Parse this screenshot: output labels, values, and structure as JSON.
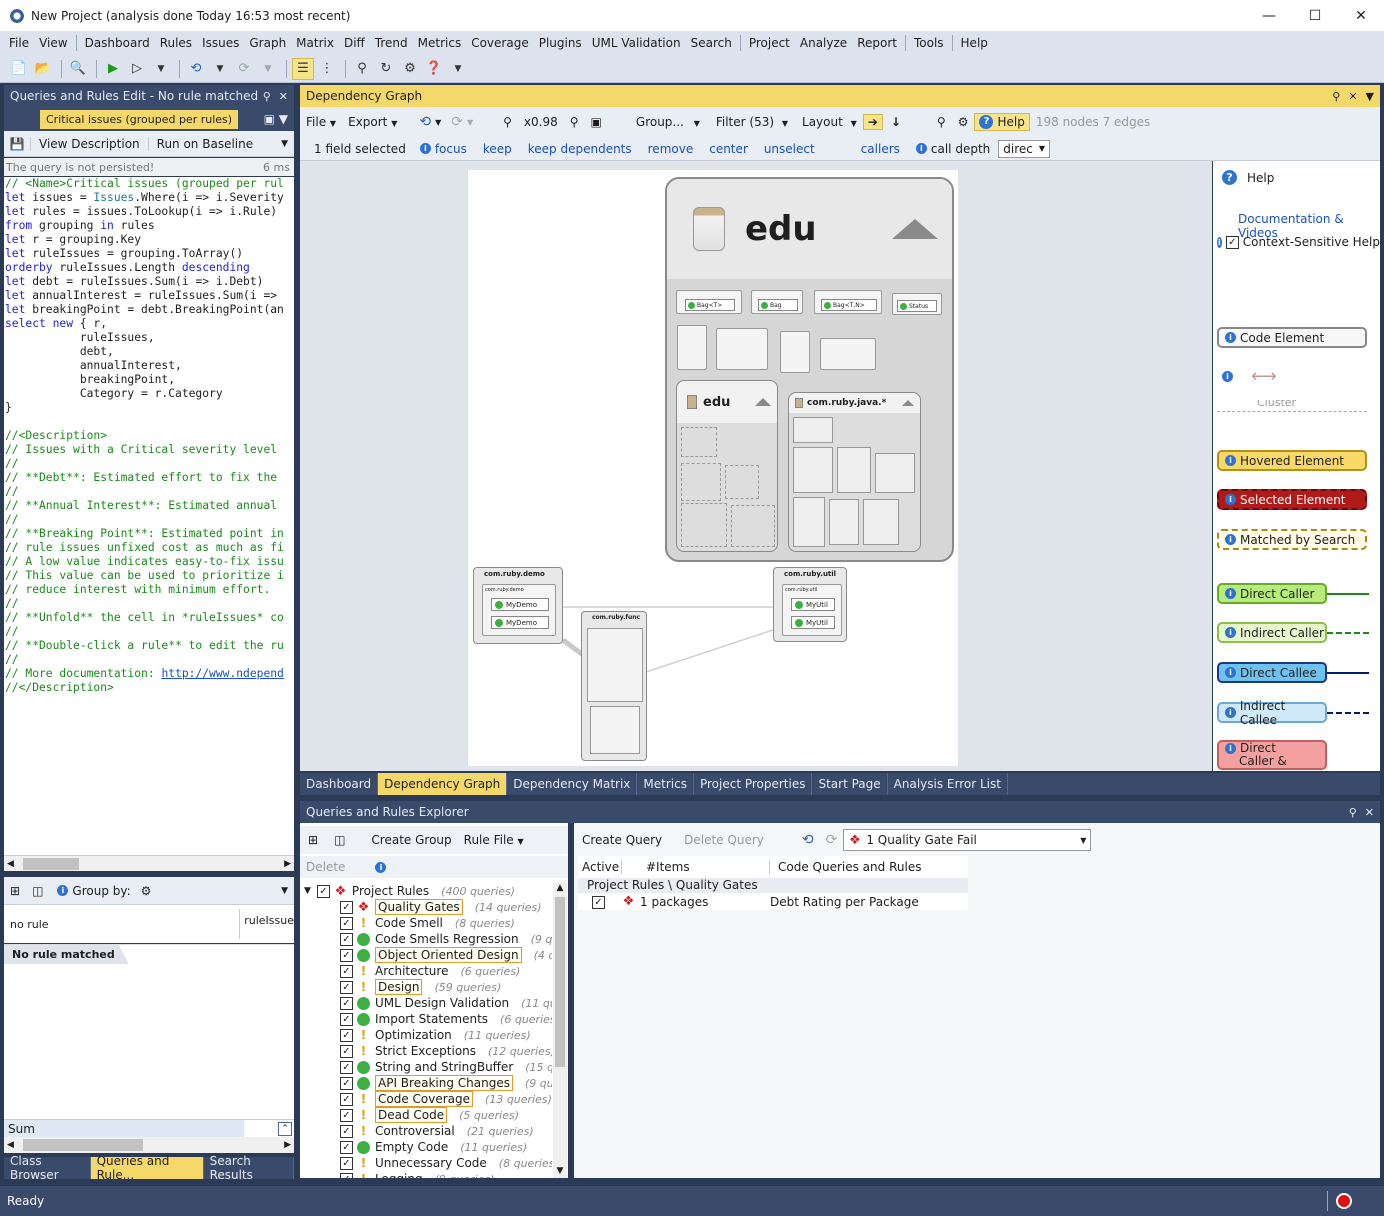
{
  "window": {
    "title": "New Project  (analysis done Today 16:53 most recent)"
  },
  "menu": [
    "File",
    "View",
    "Dashboard",
    "Rules",
    "Issues",
    "Graph",
    "Matrix",
    "Diff",
    "Trend",
    "Metrics",
    "Coverage",
    "Plugins",
    "UML Validation",
    "Search",
    "Project",
    "Analyze",
    "Report",
    "Tools",
    "Help"
  ],
  "left_panel": {
    "title": "Queries and Rules Edit  - No rule matched",
    "query_tab": "Critical issues (grouped per rules)",
    "view_description": "View Description",
    "run_on_baseline": "Run on Baseline",
    "status": "The query is not persisted!",
    "status_time": "6 ms",
    "group_by": "Group by:",
    "col_no_rule": "no rule",
    "col_ruleissues": "ruleIssue",
    "no_rule_matched": "No rule matched",
    "sum": "Sum"
  },
  "left_tabs": [
    "Class Browser",
    "Queries and Rule...",
    "Search Results"
  ],
  "graph_panel": {
    "title": "Dependency Graph",
    "file": "File",
    "export": "Export",
    "zoom": "x0.98",
    "group": "Group...",
    "filter": "Filter (53)",
    "layout": "Layout",
    "help": "Help",
    "stats": "198 nodes 7 edges",
    "selected": "1 field selected",
    "actions": [
      "focus",
      "keep",
      "keep dependents",
      "remove",
      "center",
      "unselect"
    ],
    "callers": "callers",
    "call_depth": "call depth",
    "direc": "direc"
  },
  "graph": {
    "edu_title": "edu",
    "edu_inner": "edu",
    "ruby_java": "com.ruby.java.*",
    "demo": "com.ruby.demo",
    "demo_inner": "com.ruby.demo",
    "my_demo_1": "MyDemo",
    "my_demo_2": "MyDemo",
    "func": "com.ruby.func",
    "util": "com.ruby.util",
    "util_inner": "com.ruby.util",
    "my_util_1": "MyUtil",
    "my_util_2": "MyUtil",
    "bag1": "Bag<T>",
    "bag2": "Bag",
    "bag3": "Bag<T,N>",
    "status": "Status"
  },
  "legend": {
    "help": "Help",
    "doc": "Documentation & Videos",
    "context": "Context-Sensitive Help",
    "code_element": "Code Element",
    "cluster": "Cluster",
    "hovered": "Hovered Element",
    "selected": "Selected Element",
    "matched": "Matched by Search",
    "direct_caller": "Direct Caller",
    "indirect_caller": "Indirect Caller",
    "direct_callee": "Direct Callee",
    "indirect_callee": "Indirect Callee",
    "direct_caller_callee": "Direct",
    "caller_callee": "Caller & Callee"
  },
  "center_tabs": [
    "Dashboard",
    "Dependency Graph",
    "Dependency Matrix",
    "Metrics",
    "Project Properties",
    "Start Page",
    "Analysis Error List"
  ],
  "explorer": {
    "title": "Queries and Rules Explorer",
    "create_group": "Create Group",
    "rule_file": "Rule File",
    "delete": "Delete",
    "create_query": "Create Query",
    "delete_query": "Delete Query",
    "quality_gate": "1 Quality Gate Fail",
    "col_active": "Active",
    "col_items": "#Items",
    "col_code": "Code Queries and Rules",
    "group_path": "Project Rules \\ Quality Gates",
    "row_items": "1 packages",
    "row_name": "Debt Rating per Package",
    "tree_root": "Project Rules",
    "tree_root_count": "(400 queries)",
    "tree": [
      {
        "name": "Quality Gates",
        "count": "(14 queries)",
        "icon": "red",
        "boxed": true
      },
      {
        "name": "Code Smell",
        "count": "(8 queries)",
        "icon": "warn",
        "boxed": false
      },
      {
        "name": "Code Smells Regression",
        "count": "(9 que",
        "icon": "green",
        "boxed": false
      },
      {
        "name": "Object Oriented Design",
        "count": "(4 que",
        "icon": "green",
        "boxed": true
      },
      {
        "name": "Architecture",
        "count": "(6 queries)",
        "icon": "warn",
        "boxed": false
      },
      {
        "name": "Design",
        "count": "(59 queries)",
        "icon": "warn",
        "boxed": true
      },
      {
        "name": "UML Design Validation",
        "count": "(11 que",
        "icon": "green",
        "boxed": false
      },
      {
        "name": "Import Statements",
        "count": "(6 queries)",
        "icon": "green",
        "boxed": false
      },
      {
        "name": "Optimization",
        "count": "(11 queries)",
        "icon": "warn",
        "boxed": false
      },
      {
        "name": "Strict Exceptions",
        "count": "(12 queries)",
        "icon": "warn",
        "boxed": false
      },
      {
        "name": "String and StringBuffer",
        "count": "(15 qu",
        "icon": "green",
        "boxed": false
      },
      {
        "name": "API Breaking Changes",
        "count": "(9 querie",
        "icon": "green",
        "boxed": true
      },
      {
        "name": "Code Coverage",
        "count": "(13 queries)",
        "icon": "warn",
        "boxed": true
      },
      {
        "name": "Dead Code",
        "count": "(5 queries)",
        "icon": "warn",
        "boxed": true
      },
      {
        "name": "Controversial",
        "count": "(21 queries)",
        "icon": "warn",
        "boxed": false
      },
      {
        "name": "Empty Code",
        "count": "(11 queries)",
        "icon": "green",
        "boxed": false
      },
      {
        "name": "Unnecessary Code",
        "count": "(8 queries)",
        "icon": "warn",
        "boxed": false
      },
      {
        "name": "Logging",
        "count": "(9 queries)",
        "icon": "warn",
        "boxed": false
      }
    ]
  },
  "statusbar": {
    "text": "Ready"
  },
  "code_link": "http://www.ndepend"
}
